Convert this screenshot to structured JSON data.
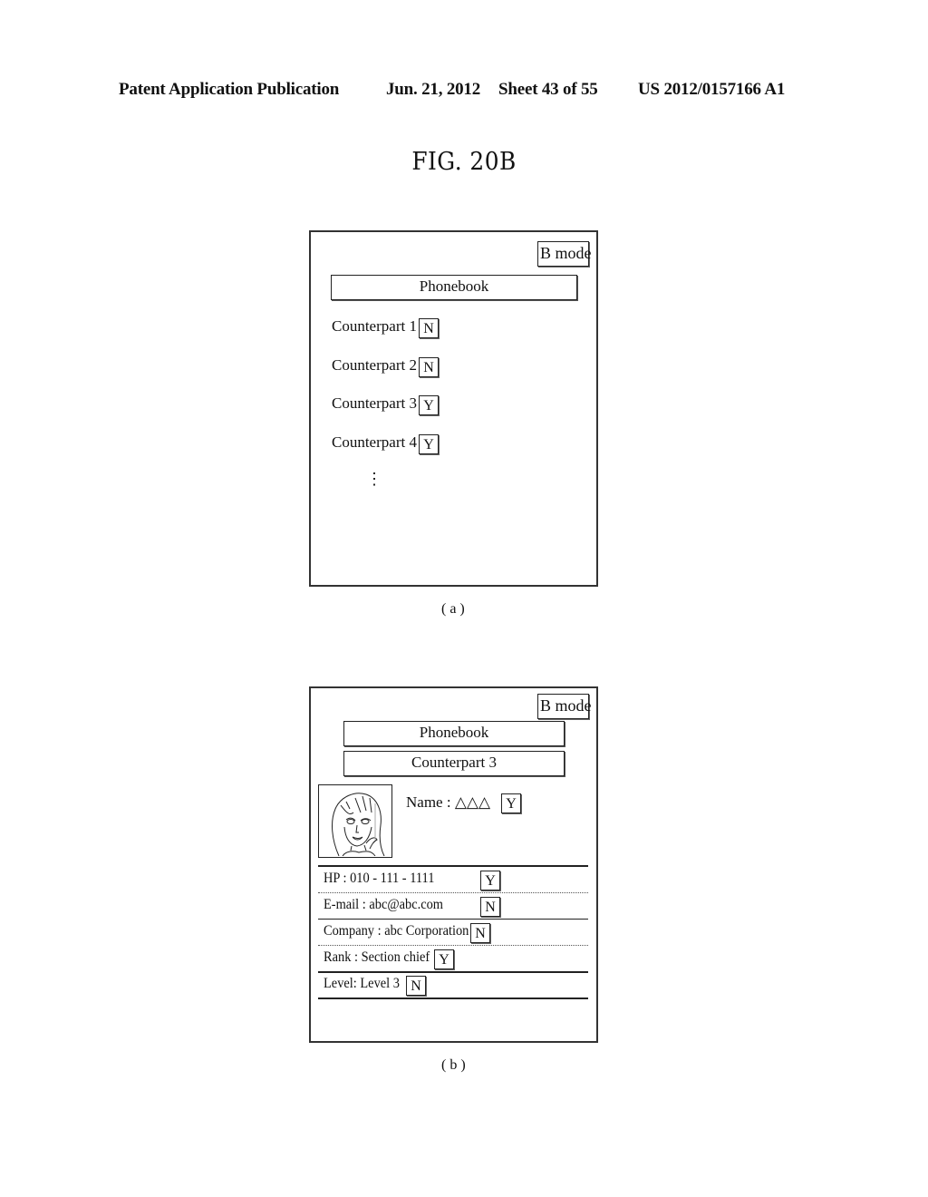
{
  "header": {
    "publication": "Patent Application Publication",
    "date": "Jun. 21, 2012",
    "sheet": "Sheet 43 of 55",
    "number": "US 2012/0157166 A1"
  },
  "figure": {
    "title": "FIG. 20B"
  },
  "panel_a": {
    "mode_button": "B mode",
    "title_bar": "Phonebook",
    "items": [
      {
        "label": "Counterpart 1",
        "flag": "N"
      },
      {
        "label": "Counterpart 2",
        "flag": "N"
      },
      {
        "label": "Counterpart 3",
        "flag": "Y"
      },
      {
        "label": "Counterpart 4",
        "flag": "Y"
      }
    ],
    "more_indicator": "⋮",
    "caption": "( a )"
  },
  "panel_b": {
    "mode_button": "B mode",
    "title_bar": "Phonebook",
    "subtitle_bar": "Counterpart 3",
    "photo_icon": "portrait-photo",
    "name": {
      "label": "Name : △△△",
      "flag": "Y"
    },
    "fields": [
      {
        "label": "HP : 010 - 111 - 1111",
        "flag": "Y"
      },
      {
        "label": "E-mail : abc@abc.com",
        "flag": "N"
      },
      {
        "label": "Company : abc Corporation",
        "flag": "N"
      },
      {
        "label": "Rank : Section chief",
        "flag": "Y"
      },
      {
        "label": "Level: Level 3",
        "flag": "N"
      }
    ],
    "caption": "( b )"
  }
}
